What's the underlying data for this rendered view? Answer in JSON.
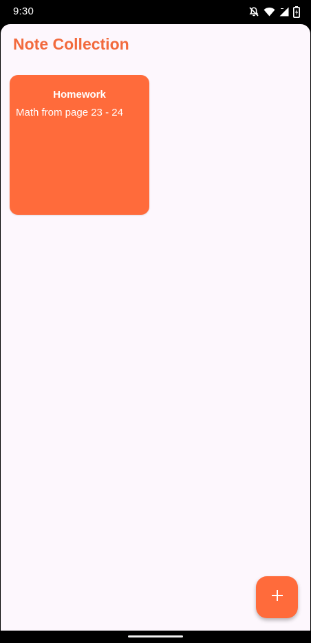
{
  "status_bar": {
    "time": "9:30",
    "icons": [
      "notifications-off-icon",
      "wifi-icon",
      "signal-icon",
      "battery-charging-icon"
    ]
  },
  "app": {
    "title": "Note Collection",
    "notes": [
      {
        "title": "Homework",
        "body": "Math from page 23 - 24"
      }
    ],
    "fab_icon": "add-icon"
  },
  "colors": {
    "accent": "#ff6b3b",
    "title": "#f26a3d",
    "background": "#fdf7fd"
  }
}
